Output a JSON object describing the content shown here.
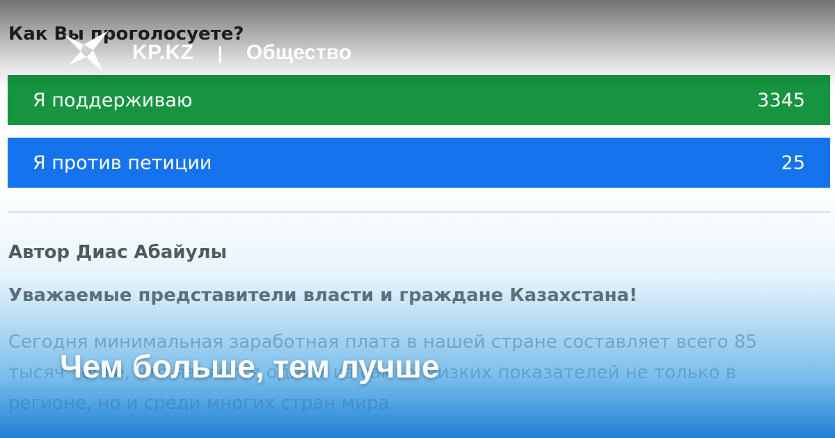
{
  "poll": {
    "question": "Как Вы проголосуете?",
    "options": [
      {
        "label": "Я поддерживаю",
        "count": "3345",
        "color": "#16943f"
      },
      {
        "label": "Я против петиции",
        "count": "25",
        "color": "#1673ee"
      }
    ]
  },
  "article": {
    "author": "Автор Диас Абайулы",
    "greeting": "Уважаемые представители власти и граждане Казахстана!",
    "body": "Сегодня минимальная заработная плата в нашей стране составляет всего 85 тысяч тенге, что является одним из самых низких показателей не только в регионе, но и среди многих стран мира."
  },
  "brand": {
    "site": "KP.KZ",
    "separator": "|",
    "section": "Общество",
    "logo_icon": "swallow-bird-icon"
  },
  "headline": "Чем больше, тем лучше"
}
